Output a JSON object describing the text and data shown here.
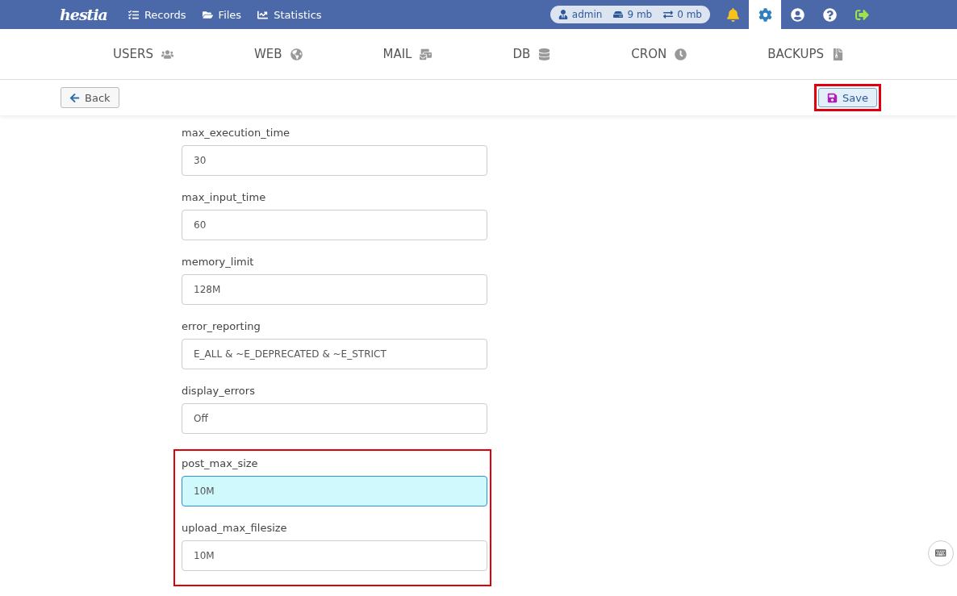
{
  "topbar": {
    "logo": "hestia",
    "menu": [
      "Records",
      "Files",
      "Statistics"
    ],
    "usage": {
      "user": "admin",
      "disk": "9 mb",
      "bandwidth": "0 mb"
    },
    "icon_buttons": [
      {
        "selected": false
      },
      {
        "selected": true
      },
      {
        "selected": false
      },
      {
        "selected": false
      },
      {
        "selected": false
      }
    ]
  },
  "tabs": [
    "USERS",
    "WEB",
    "MAIL",
    "DB",
    "CRON",
    "BACKUPS"
  ],
  "toolbar": {
    "back": "Back",
    "save": "Save",
    "save_highlighted": true
  },
  "fields": [
    {
      "label": "max_execution_time",
      "value": "30",
      "focused": false,
      "highlighted": false
    },
    {
      "label": "max_input_time",
      "value": "60",
      "focused": false,
      "highlighted": false
    },
    {
      "label": "memory_limit",
      "value": "128M",
      "focused": false,
      "highlighted": false
    },
    {
      "label": "error_reporting",
      "value": "E_ALL & ~E_DEPRECATED & ~E_STRICT",
      "focused": false,
      "highlighted": false
    },
    {
      "label": "display_errors",
      "value": "Off",
      "focused": false,
      "highlighted": false
    },
    {
      "label": "post_max_size",
      "value": "10M",
      "focused": true,
      "highlighted": true
    },
    {
      "label": "upload_max_filesize",
      "value": "10M",
      "focused": false,
      "highlighted": true
    }
  ]
}
